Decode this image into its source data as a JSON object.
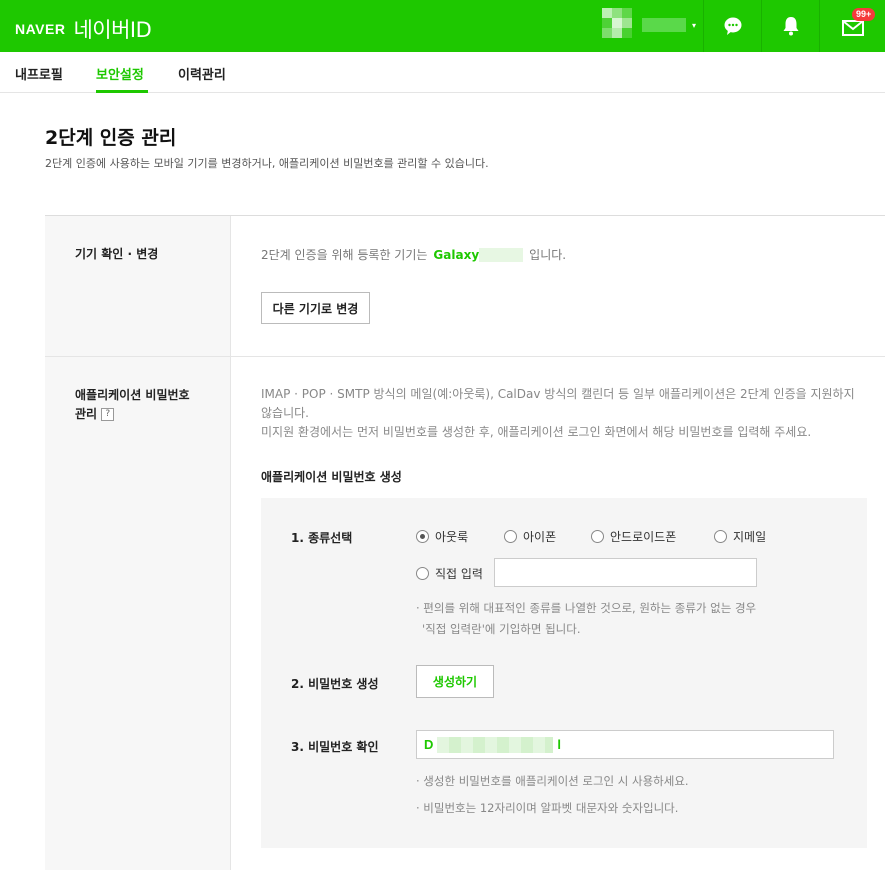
{
  "header": {
    "logo_naver": "NAVER",
    "logo_id": "네이버ID",
    "mail_badge": "99+",
    "caret": "▾"
  },
  "tabs": [
    {
      "label": "내프로필",
      "active": false
    },
    {
      "label": "보안설정",
      "active": true
    },
    {
      "label": "이력관리",
      "active": false
    }
  ],
  "page": {
    "title": "2단계 인증 관리",
    "description": "2단계 인증에 사용하는 모바일 기기를 변경하거나, 애플리케이션 비밀번호를 관리할 수 있습니다."
  },
  "device_section": {
    "label": "기기 확인 · 변경",
    "text_before": "2단계 인증을 위해 등록한 기기는",
    "device_name": "Galaxy",
    "text_after": "입니다.",
    "change_button": "다른 기기로 변경"
  },
  "app_password_section": {
    "label_line1": "애플리케이션 비밀번호",
    "label_line2": "관리",
    "help_icon": "?",
    "desc_line1": "IMAP · POP · SMTP 방식의 메일(예:아웃룩), CalDav 방식의 캘린더 등 일부 애플리케이션은 2단계 인증을 지원하지 않습니다.",
    "desc_line2": "미지원 환경에서는 먼저 비밀번호를 생성한 후, 애플리케이션 로그인 화면에서 해당 비밀번호를 입력해 주세요.",
    "subtitle": "애플리케이션 비밀번호 생성",
    "step1_label": "1. 종류선택",
    "radio_options": [
      {
        "label": "아웃룩",
        "checked": true
      },
      {
        "label": "아이폰",
        "checked": false
      },
      {
        "label": "안드로이드폰",
        "checked": false
      },
      {
        "label": "지메일",
        "checked": false
      },
      {
        "label": "직접 입력",
        "checked": false
      }
    ],
    "direct_input_value": "",
    "step1_note_line1": "· 편의를 위해 대표적인 종류를 나열한 것으로, 원하는 종류가 없는 경우",
    "step1_note_line2": "'직접 입력란'에 기입하면 됩니다.",
    "step2_label": "2. 비밀번호 생성",
    "generate_button": "생성하기",
    "step3_label": "3. 비밀번호 확인",
    "password_first": "D",
    "password_last": "l",
    "step3_note1": "· 생성한 비밀번호를 애플리케이션 로그인 시 사용하세요.",
    "step3_note2": "· 비밀번호는 12자리이며 알파벳 대문자와 숫자입니다."
  },
  "colors": {
    "brand_green": "#1ec800",
    "badge_red": "#f53b3b"
  }
}
